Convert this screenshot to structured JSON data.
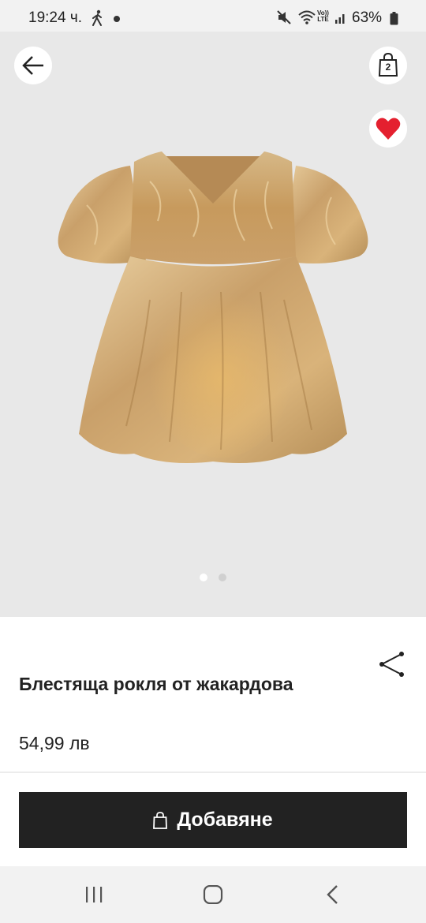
{
  "status_bar": {
    "time": "19:24 ч.",
    "volte_top": "Vo))",
    "volte_bottom": "LTE",
    "battery": "63%"
  },
  "gallery": {
    "bag_count": "2",
    "favorite_color": "#e4202f",
    "pager": {
      "total": 2,
      "active": 0
    }
  },
  "product": {
    "title": "Блестяща рокля от жакардова",
    "price": "54,99 лв"
  },
  "actions": {
    "add_label": "Добавяне"
  },
  "icons": {
    "back": "arrow-left-icon",
    "bag": "shopping-bag-icon",
    "favorite": "heart-icon",
    "share": "share-icon"
  }
}
